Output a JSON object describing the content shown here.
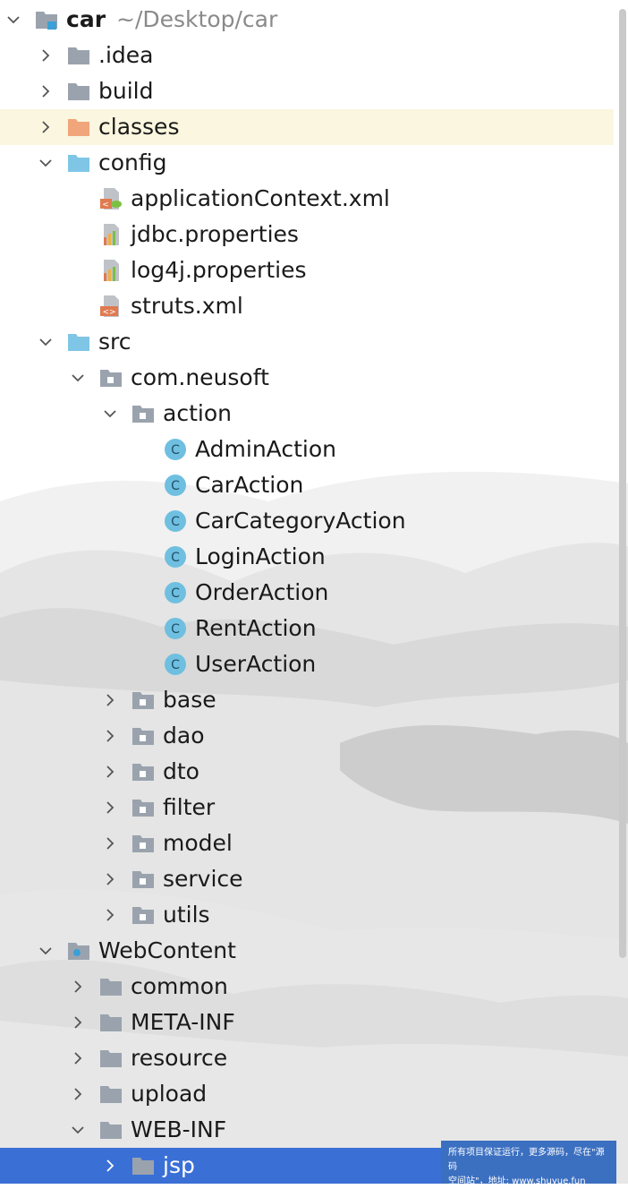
{
  "project": {
    "name": "car",
    "path": "~/Desktop/car"
  },
  "tree": [
    {
      "id": "idea",
      "label": ".idea",
      "depth": 1,
      "chevron": "right",
      "icon": "folder-gray"
    },
    {
      "id": "build",
      "label": "build",
      "depth": 1,
      "chevron": "right",
      "icon": "folder-gray"
    },
    {
      "id": "classes",
      "label": "classes",
      "depth": 1,
      "chevron": "right",
      "icon": "folder-orange",
      "highlight": true
    },
    {
      "id": "config",
      "label": "config",
      "depth": 1,
      "chevron": "down",
      "icon": "folder-blue"
    },
    {
      "id": "applicationContext",
      "label": "applicationContext.xml",
      "depth": 2,
      "chevron": "none",
      "icon": "spring-xml-file"
    },
    {
      "id": "jdbc",
      "label": "jdbc.properties",
      "depth": 2,
      "chevron": "none",
      "icon": "properties-file"
    },
    {
      "id": "log4j",
      "label": "log4j.properties",
      "depth": 2,
      "chevron": "none",
      "icon": "properties-file"
    },
    {
      "id": "struts",
      "label": "struts.xml",
      "depth": 2,
      "chevron": "none",
      "icon": "xml-file"
    },
    {
      "id": "src",
      "label": "src",
      "depth": 1,
      "chevron": "down",
      "icon": "folder-blue"
    },
    {
      "id": "com-neusoft",
      "label": "com.neusoft",
      "depth": 2,
      "chevron": "down",
      "icon": "package"
    },
    {
      "id": "action",
      "label": "action",
      "depth": 3,
      "chevron": "down",
      "icon": "package"
    },
    {
      "id": "AdminAction",
      "label": "AdminAction",
      "depth": 4,
      "chevron": "none",
      "icon": "class"
    },
    {
      "id": "CarAction",
      "label": "CarAction",
      "depth": 4,
      "chevron": "none",
      "icon": "class"
    },
    {
      "id": "CarCategoryAction",
      "label": "CarCategoryAction",
      "depth": 4,
      "chevron": "none",
      "icon": "class"
    },
    {
      "id": "LoginAction",
      "label": "LoginAction",
      "depth": 4,
      "chevron": "none",
      "icon": "class"
    },
    {
      "id": "OrderAction",
      "label": "OrderAction",
      "depth": 4,
      "chevron": "none",
      "icon": "class"
    },
    {
      "id": "RentAction",
      "label": "RentAction",
      "depth": 4,
      "chevron": "none",
      "icon": "class"
    },
    {
      "id": "UserAction",
      "label": "UserAction",
      "depth": 4,
      "chevron": "none",
      "icon": "class"
    },
    {
      "id": "base",
      "label": "base",
      "depth": 3,
      "chevron": "right",
      "icon": "package"
    },
    {
      "id": "dao",
      "label": "dao",
      "depth": 3,
      "chevron": "right",
      "icon": "package"
    },
    {
      "id": "dto",
      "label": "dto",
      "depth": 3,
      "chevron": "right",
      "icon": "package"
    },
    {
      "id": "filter",
      "label": "filter",
      "depth": 3,
      "chevron": "right",
      "icon": "package"
    },
    {
      "id": "model",
      "label": "model",
      "depth": 3,
      "chevron": "right",
      "icon": "package"
    },
    {
      "id": "service",
      "label": "service",
      "depth": 3,
      "chevron": "right",
      "icon": "package"
    },
    {
      "id": "utils",
      "label": "utils",
      "depth": 3,
      "chevron": "right",
      "icon": "package"
    },
    {
      "id": "WebContent",
      "label": "WebContent",
      "depth": 1,
      "chevron": "down",
      "icon": "web-folder"
    },
    {
      "id": "common",
      "label": "common",
      "depth": 2,
      "chevron": "right",
      "icon": "folder-gray"
    },
    {
      "id": "META-INF",
      "label": "META-INF",
      "depth": 2,
      "chevron": "right",
      "icon": "folder-gray"
    },
    {
      "id": "resource",
      "label": "resource",
      "depth": 2,
      "chevron": "right",
      "icon": "folder-gray"
    },
    {
      "id": "upload",
      "label": "upload",
      "depth": 2,
      "chevron": "right",
      "icon": "folder-gray"
    },
    {
      "id": "WEB-INF",
      "label": "WEB-INF",
      "depth": 2,
      "chevron": "down",
      "icon": "folder-gray"
    },
    {
      "id": "jsp",
      "label": "jsp",
      "depth": 3,
      "chevron": "right",
      "icon": "folder-gray",
      "selected": true
    }
  ],
  "watermark": {
    "line1": "所有项目保证运行，更多源码，尽在\"源码",
    "line2": "空间站\"，地址: www.shuyue.fun"
  },
  "colors": {
    "selection": "#3a6fd6",
    "highlight": "#faf5dc",
    "folder_gray": "#9aa3ad",
    "folder_blue": "#7fc6e6",
    "folder_orange": "#f0a57a",
    "class_icon": "#6fbfe0"
  }
}
